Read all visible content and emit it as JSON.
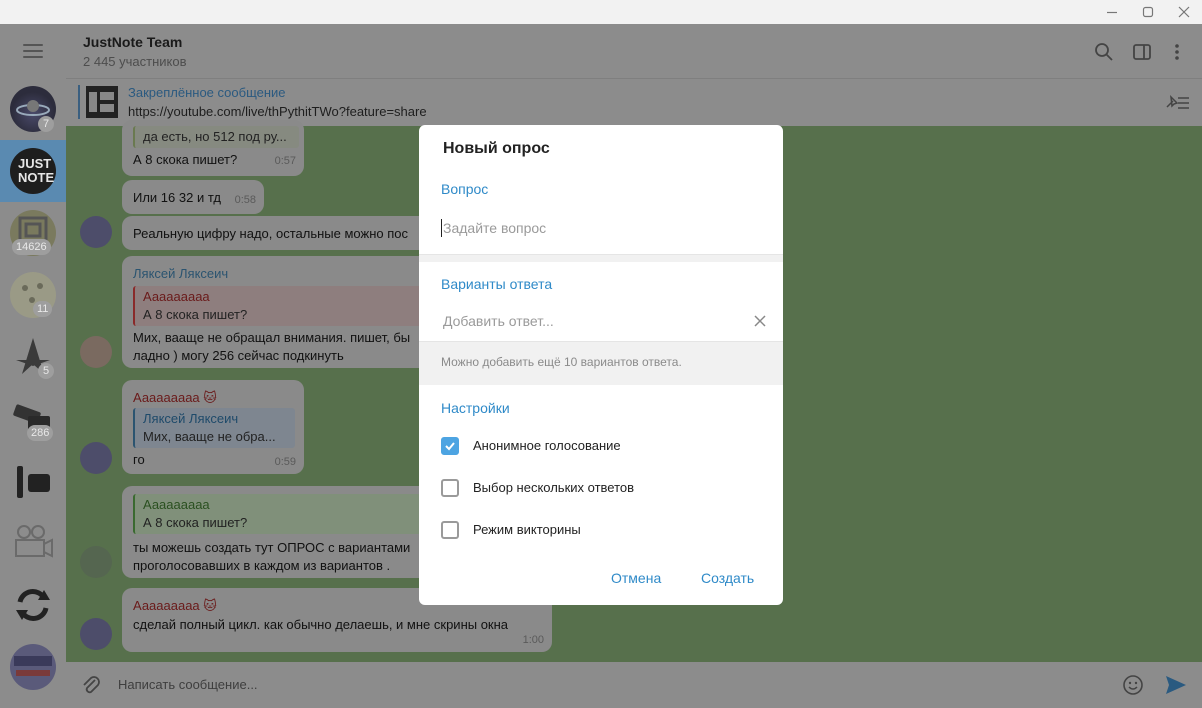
{
  "window": {
    "minimize_icon": "minimize-icon",
    "maximize_icon": "maximize-icon",
    "close_icon": "close-icon"
  },
  "sidebar": {
    "menu_icon": "menu-icon",
    "chats": [
      {
        "badge": "7"
      },
      {
        "logo_text": "JUST NOTE",
        "badge": ""
      },
      {
        "badge": "14626"
      },
      {
        "badge": "11"
      },
      {
        "badge": "5"
      },
      {
        "badge": "286"
      },
      {
        "badge": ""
      },
      {
        "badge": ""
      },
      {
        "badge": ""
      },
      {
        "badge": ""
      }
    ]
  },
  "chat": {
    "title": "JustNote Team",
    "members": "2 445 участников",
    "pinned_label": "Закреплённое сообщение",
    "pinned_text": "https://youtube.com/live/thPythitTWo?feature=share",
    "input_placeholder": "Написать сообщение...",
    "messages": [
      {
        "quote": "да есть, но 512 под ру...",
        "text": "А 8 скока пишет?",
        "time": "0:57"
      },
      {
        "text": "Или 16 32 и тд",
        "time": "0:58"
      },
      {
        "text": "Реальную цифру надо, остальные можно пос"
      },
      {
        "sender": "Ляксей Ляксеич",
        "quote_name": "Ааааааааа",
        "quote_text": "А 8 скока пишет?",
        "text1": "Мих, ваащe не обращал внимания. пишет, бы",
        "text2": "ладно ) могу 256 сейчас подкинуть"
      },
      {
        "sender": "Ааааааааа 🐱",
        "quote_name": "Ляксей Ляксеич",
        "quote_text": "Мих, ваащe не обра...",
        "text": "го",
        "time": "0:59"
      },
      {
        "quote_name": "Ааааааааа",
        "quote_text": "А 8 скока пишет?",
        "text1": "ты можешь создать тут ОПРОС  с вариантами",
        "text2": "проголосовавших в каждом из вариантов ."
      },
      {
        "sender": "Ааааааааа 🐱",
        "text": "сделай полный цикл. как обычно делаешь, и мне скрины окна",
        "time": "1:00"
      }
    ]
  },
  "poll": {
    "title": "Новый опрос",
    "question_section": "Вопрос",
    "question_placeholder": "Задайте вопрос",
    "answers_section": "Варианты ответа",
    "answer_placeholder": "Добавить ответ...",
    "answers_hint": "Можно добавить ещё 10 вариантов ответа.",
    "settings_section": "Настройки",
    "options": [
      {
        "label": "Анонимное голосование",
        "checked": true
      },
      {
        "label": "Выбор нескольких ответов",
        "checked": false
      },
      {
        "label": "Режим викторины",
        "checked": false
      }
    ],
    "cancel": "Отмена",
    "create": "Создать"
  },
  "colors": {
    "accent": "#2f8ac8",
    "checkbox_on": "#4da4e2",
    "dim_overlay": "#8a8a8a"
  }
}
